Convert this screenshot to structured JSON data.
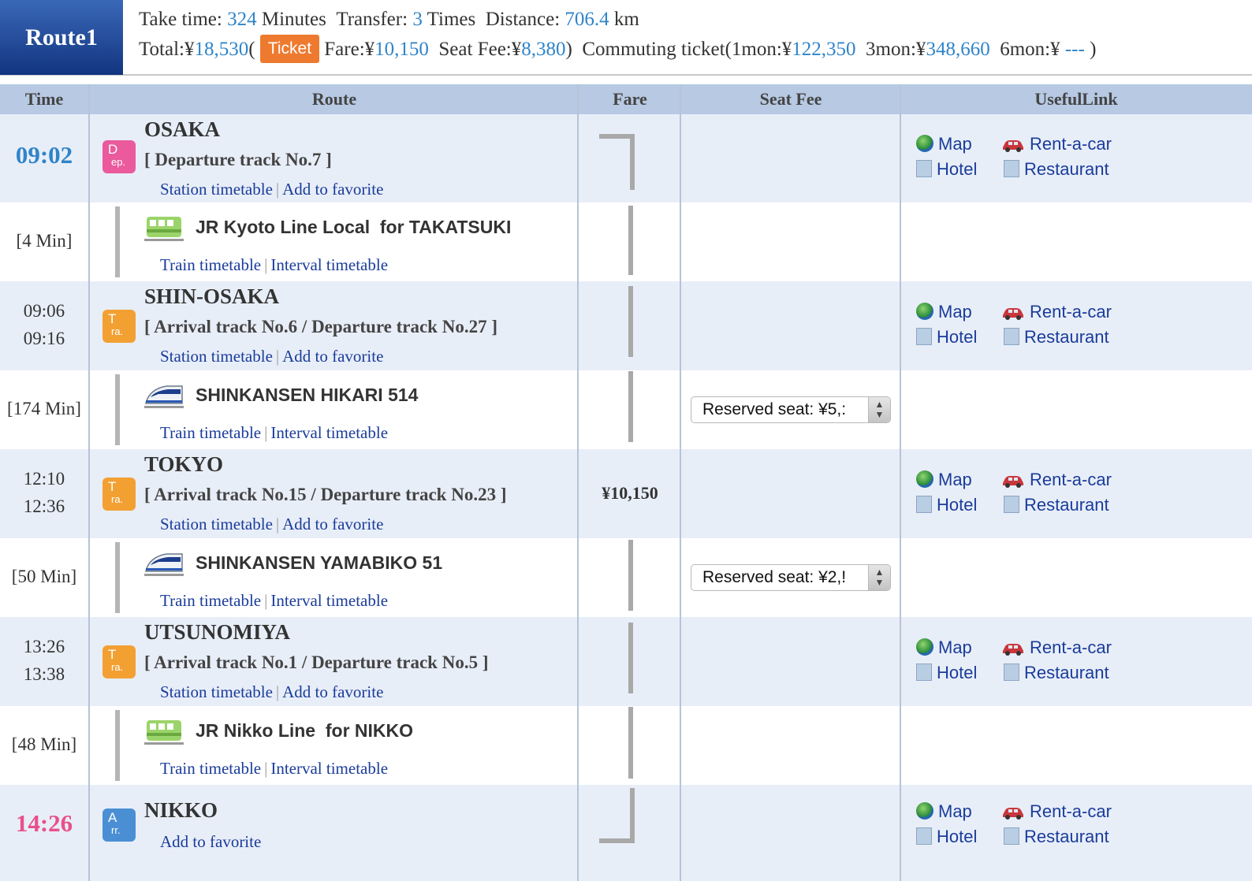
{
  "route": {
    "label": "Route1",
    "take_time_label": "Take time:",
    "take_time_value": "324",
    "take_time_unit": "Minutes",
    "transfer_label": "Transfer:",
    "transfer_value": "3",
    "transfer_unit": "Times",
    "distance_label": "Distance:",
    "distance_value": "706.4",
    "distance_unit": "km",
    "total_label": "Total:¥",
    "total_value": "18,530",
    "paren_open": "(",
    "ticket_button": "Ticket",
    "fare_label": "Fare:¥",
    "fare_value": "10,150",
    "seat_label": "Seat Fee:¥",
    "seat_value": "8,380",
    "commute_label": ")  Commuting ticket(1mon:¥",
    "commute_1mon": "122,350",
    "commute_3mon_label": "3mon:¥",
    "commute_3mon": "348,660",
    "commute_6mon_label": "6mon:¥",
    "commute_6mon": "---",
    "paren_close": ")"
  },
  "columns": {
    "time": "Time",
    "route": "Route",
    "fare": "Fare",
    "seat_fee": "Seat Fee",
    "useful_link": "UsefulLink"
  },
  "links": {
    "station_timetable": "Station timetable",
    "add_favorite": "Add to favorite",
    "train_timetable": "Train timetable",
    "interval_timetable": "Interval timetable",
    "separator": "|",
    "map": "Map",
    "hotel": "Hotel",
    "rent_a_car": "Rent-a-car",
    "restaurant": "Restaurant"
  },
  "stations": [
    {
      "name": "OSAKA",
      "times": [
        "09:02"
      ],
      "track": "[ Departure track No.7 ]",
      "icon": "Dep.",
      "icon_a": "D",
      "icon_b": "ep."
    },
    {
      "name": "SHIN-OSAKA",
      "times": [
        "09:06",
        "09:16"
      ],
      "track": "[ Arrival track No.6 / Departure track No.27 ]",
      "icon_a": "T",
      "icon_b": "ra."
    },
    {
      "name": "TOKYO",
      "times": [
        "12:10",
        "12:36"
      ],
      "track": "[ Arrival track No.15 / Departure track No.23 ]",
      "icon_a": "T",
      "icon_b": "ra."
    },
    {
      "name": "UTSUNOMIYA",
      "times": [
        "13:26",
        "13:38"
      ],
      "track": "[ Arrival track No.1 / Departure track No.5 ]",
      "icon_a": "T",
      "icon_b": "ra."
    },
    {
      "name": "NIKKO",
      "times": [
        "14:26"
      ],
      "icon_a": "A",
      "icon_b": "rr."
    }
  ],
  "segments": [
    {
      "duration": "[4 Min]",
      "train": "JR Kyoto Line Local  for TAKATSUKI",
      "train_icon": "local-train-icon"
    },
    {
      "duration": "[174 Min]",
      "train": "SHINKANSEN HIKARI 514",
      "train_icon": "shinkansen-icon",
      "seat": "Reserved seat: ¥5,:"
    },
    {
      "duration": "[50 Min]",
      "train": "SHINKANSEN YAMABIKO 51",
      "train_icon": "shinkansen-icon",
      "seat": "Reserved seat: ¥2,!"
    },
    {
      "duration": "[48 Min]",
      "train": "JR Nikko Line  for NIKKO",
      "train_icon": "local-train-icon"
    }
  ],
  "fare_amount": "¥10,150",
  "colors": {
    "accent_blue": "#2f84c9",
    "header_navy": "#12357f",
    "ticket_orange": "#ee7a2f",
    "arrival_pink": "#e8508a"
  }
}
